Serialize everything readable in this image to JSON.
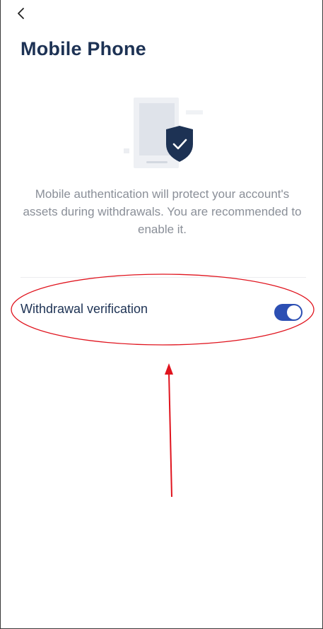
{
  "header": {
    "back_icon": "chevron-left-icon",
    "title": "Mobile Phone"
  },
  "illustration": {
    "icon": "phone-shield-check-icon",
    "colors": {
      "phone": "#dfe3ea",
      "shield": "#1d3254"
    }
  },
  "description": "Mobile authentication will protect your account's assets during withdrawals. You are recommended to enable it.",
  "settings": {
    "withdrawal_verification": {
      "label": "Withdrawal verification",
      "enabled": true
    }
  },
  "colors": {
    "title_text": "#1d3254",
    "description_text": "#8a8f98",
    "toggle_on": "#2c4fb3",
    "annotation": "#e0141e"
  }
}
